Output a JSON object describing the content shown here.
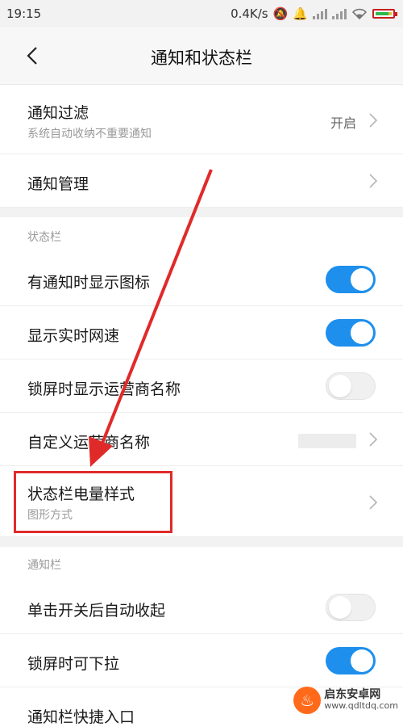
{
  "status_bar": {
    "time": "19:15",
    "speed": "0.4K/s"
  },
  "header": {
    "title": "通知和状态栏"
  },
  "notification_filter": {
    "label": "通知过滤",
    "subtitle": "系统自动收纳不重要通知",
    "value": "开启"
  },
  "notification_manage": {
    "label": "通知管理"
  },
  "status_section": {
    "label": "状态栏",
    "items": [
      {
        "label": "有通知时显示图标",
        "toggle": true
      },
      {
        "label": "显示实时网速",
        "toggle": true
      },
      {
        "label": "锁屏时显示运营商名称",
        "toggle": false
      },
      {
        "label": "自定义运营商名称"
      },
      {
        "label": "状态栏电量样式",
        "subtitle": "图形方式"
      }
    ]
  },
  "notif_section": {
    "label": "通知栏",
    "items": [
      {
        "label": "单击开关后自动收起",
        "toggle": false
      },
      {
        "label": "锁屏时可下拉",
        "toggle": true
      },
      {
        "label": "通知栏快捷入口"
      }
    ]
  },
  "watermark": {
    "name": "启东安卓网",
    "url": "www.qdltdq.com"
  },
  "colors": {
    "accent": "#1e8fec",
    "annotation": "#e02a2a"
  }
}
